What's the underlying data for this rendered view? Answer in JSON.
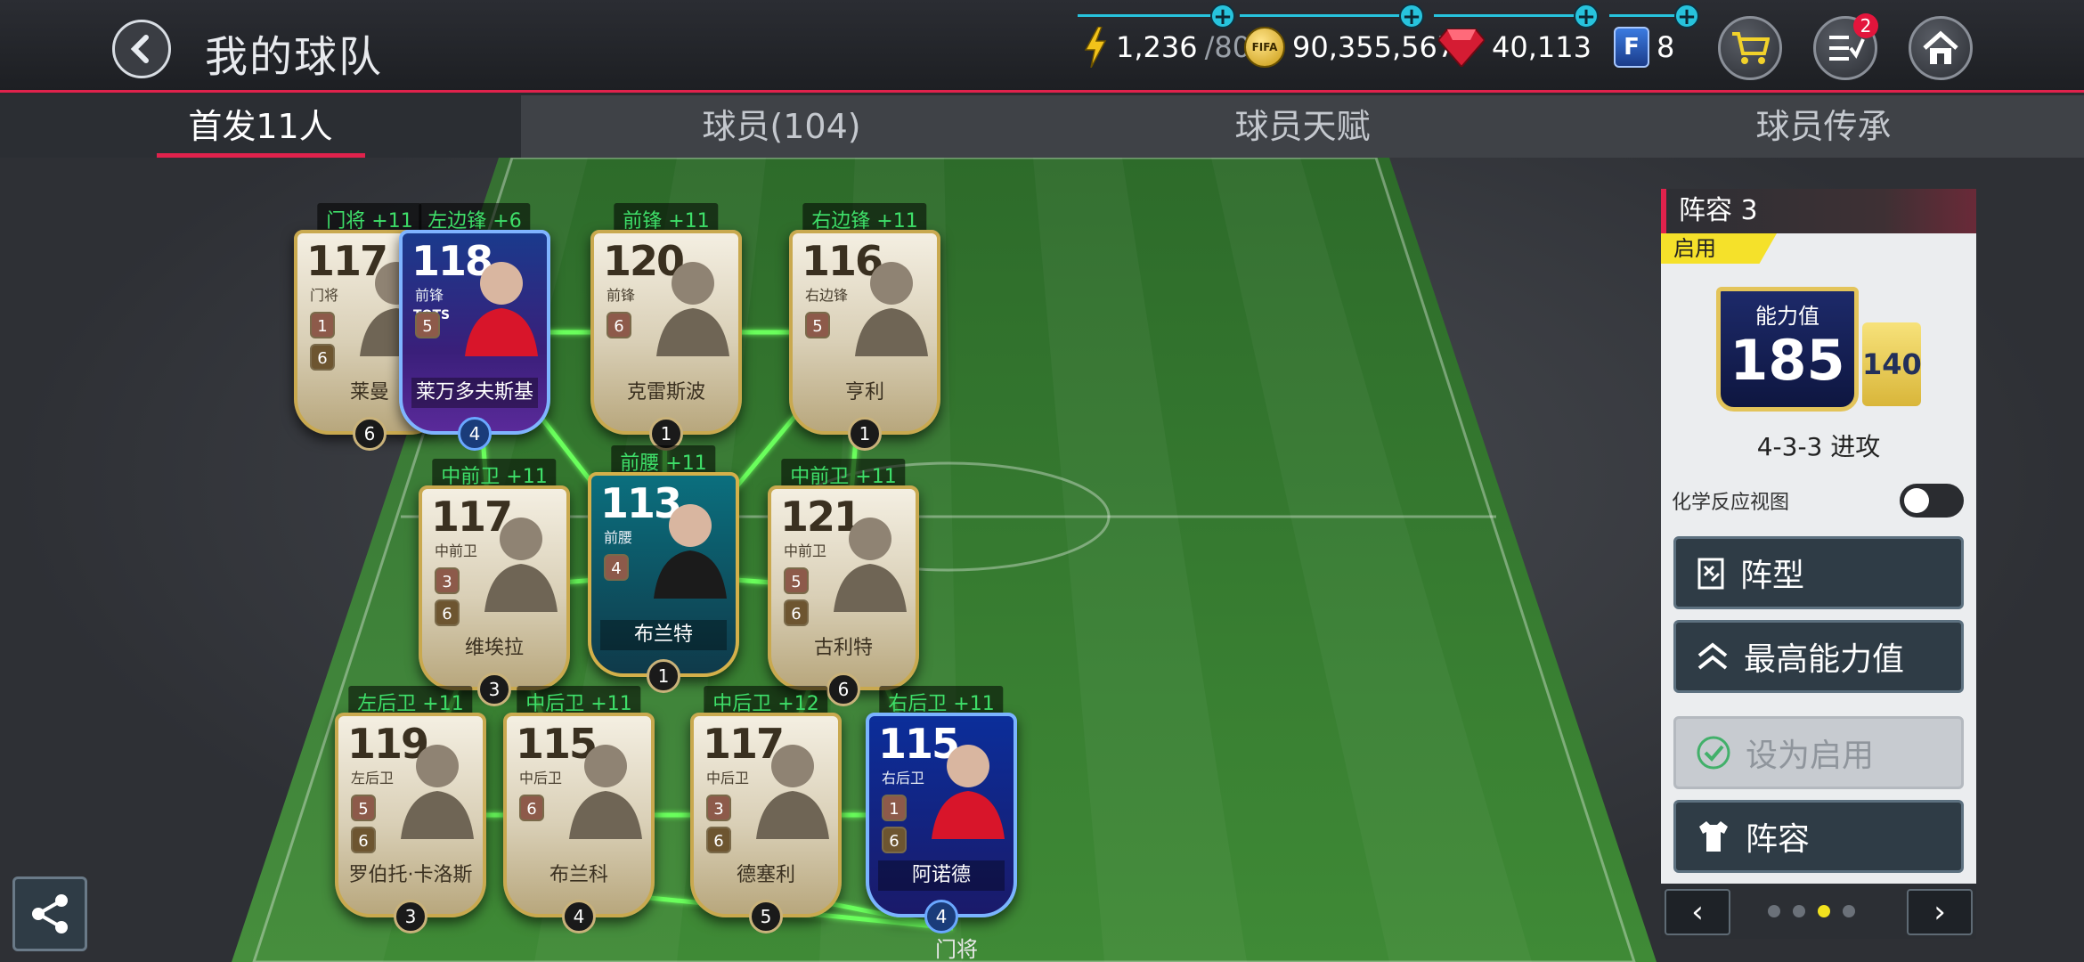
{
  "header": {
    "title": "我的球队",
    "resources": {
      "energy": "1,236",
      "energy_max": "/80",
      "coins": "90,355,567",
      "gems": "40,113",
      "fifa_points": "8"
    },
    "coin_label": "FIFA",
    "fifa_letter": "F",
    "task_badge": "2"
  },
  "tabs": [
    {
      "label": "首发11人",
      "active": true
    },
    {
      "label": "球员(104)",
      "active": false
    },
    {
      "label": "球员天赋",
      "active": false
    },
    {
      "label": "球员传承",
      "active": false
    }
  ],
  "players": [
    {
      "slot": "门将 +11",
      "rating": "117",
      "pos": "门将",
      "name": "莱曼",
      "chip1": "1",
      "chip2": "6",
      "level": "6",
      "style": "gold"
    },
    {
      "slot": "左边锋 +6",
      "rating": "118",
      "pos": "前锋",
      "name": "莱万多夫斯基",
      "chip1": "5",
      "chip2": "",
      "level": "4",
      "style": "tots",
      "tag": "TOTS"
    },
    {
      "slot": "前锋 +11",
      "rating": "120",
      "pos": "前锋",
      "name": "克雷斯波",
      "chip1": "6",
      "chip2": "",
      "level": "1",
      "style": "gold"
    },
    {
      "slot": "右边锋 +11",
      "rating": "116",
      "pos": "右边锋",
      "name": "亨利",
      "chip1": "5",
      "chip2": "",
      "level": "1",
      "style": "gold"
    },
    {
      "slot": "中前卫 +11",
      "rating": "117",
      "pos": "中前卫",
      "name": "维埃拉",
      "chip1": "3",
      "chip2": "6",
      "level": "3",
      "style": "gold"
    },
    {
      "slot": "前腰 +11",
      "rating": "113",
      "pos": "前腰",
      "name": "布兰特",
      "chip1": "4",
      "chip2": "",
      "level": "1",
      "style": "teal"
    },
    {
      "slot": "中前卫 +11",
      "rating": "121",
      "pos": "中前卫",
      "name": "古利特",
      "chip1": "5",
      "chip2": "6",
      "level": "6",
      "style": "gold"
    },
    {
      "slot": "左后卫 +11",
      "rating": "119",
      "pos": "左后卫",
      "name": "罗伯托·卡洛斯",
      "chip1": "5",
      "chip2": "6",
      "level": "3",
      "style": "gold"
    },
    {
      "slot": "中后卫 +11",
      "rating": "115",
      "pos": "中后卫",
      "name": "布兰科",
      "chip1": "6",
      "chip2": "",
      "level": "4",
      "style": "gold"
    },
    {
      "slot": "中后卫 +12",
      "rating": "117",
      "pos": "中后卫",
      "name": "德塞利",
      "chip1": "3",
      "chip2": "6",
      "level": "5",
      "style": "gold"
    },
    {
      "slot": "右后卫 +11",
      "rating": "115",
      "pos": "右后卫",
      "name": "阿诺德",
      "chip1": "1",
      "chip2": "6",
      "level": "4",
      "style": "blue"
    }
  ],
  "field": {
    "bottom_label": "门将"
  },
  "panel": {
    "lineup_title": "阵容 3",
    "enabled_tag": "启用",
    "power_label": "能力值",
    "power_value": "185",
    "sub_value": "140",
    "formation": "4-3-3 进攻",
    "chem_label": "化学反应视图",
    "buttons": {
      "formation": "阵型",
      "max_power": "最高能力值",
      "set_enabled": "设为启用",
      "lineup": "阵容"
    },
    "pager": {
      "prev": "‹",
      "next": "›",
      "pages": 4,
      "current": 3
    }
  },
  "colors": {
    "accent": "#e0224c",
    "link_line": "#5cff5c",
    "resource_plus": "#27c3dd",
    "enabled_tag": "#f5e12a"
  }
}
